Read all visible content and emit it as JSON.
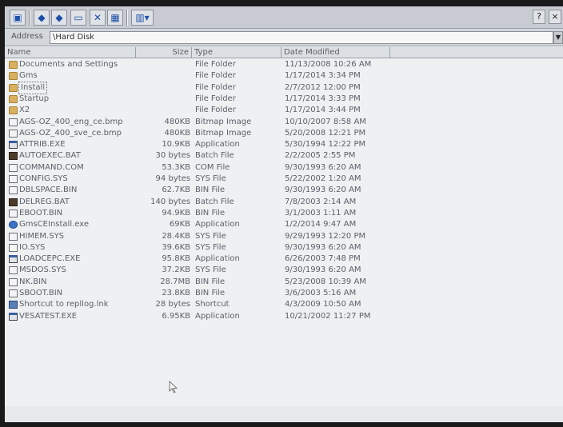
{
  "toolbar": {
    "help_label": "?",
    "close_label": "×",
    "buttons": [
      "back-icon",
      "forward-icon",
      "up-folder-icon",
      "delete-icon",
      "properties-icon",
      "views-icon"
    ]
  },
  "address": {
    "label": "Address",
    "value": "\\Hard Disk"
  },
  "columns": {
    "name": "Name",
    "size": "Size",
    "type": "Type",
    "date": "Date Modified"
  },
  "files": [
    {
      "name": "Documents and Settings",
      "size": "",
      "type": "File Folder",
      "date": "11/13/2008 10:26 AM",
      "icon": "folder-icon"
    },
    {
      "name": "Gms",
      "size": "",
      "type": "File Folder",
      "date": "1/17/2014 3:34 PM",
      "icon": "folder-icon"
    },
    {
      "name": "Install",
      "size": "",
      "type": "File Folder",
      "date": "2/7/2012 12:00 PM",
      "icon": "folder-icon"
    },
    {
      "name": "Startup",
      "size": "",
      "type": "File Folder",
      "date": "1/17/2014 3:33 PM",
      "icon": "folder-icon"
    },
    {
      "name": "X2",
      "size": "",
      "type": "File Folder",
      "date": "1/17/2014 3:44 PM",
      "icon": "folder-icon"
    },
    {
      "name": "AGS-OZ_400_eng_ce.bmp",
      "size": "480KB",
      "type": "Bitmap Image",
      "date": "10/10/2007 8:58 AM",
      "icon": "file-icon"
    },
    {
      "name": "AGS-OZ_400_sve_ce.bmp",
      "size": "480KB",
      "type": "Bitmap Image",
      "date": "5/20/2008 12:21 PM",
      "icon": "file-icon"
    },
    {
      "name": "ATTRIB.EXE",
      "size": "10.9KB",
      "type": "Application",
      "date": "5/30/1994 12:22 PM",
      "icon": "app-icon"
    },
    {
      "name": "AUTOEXEC.BAT",
      "size": "30 bytes",
      "type": "Batch File",
      "date": "2/2/2005 2:55 PM",
      "icon": "batch-icon"
    },
    {
      "name": "COMMAND.COM",
      "size": "53.3KB",
      "type": "COM File",
      "date": "9/30/1993 6:20 AM",
      "icon": "file-icon"
    },
    {
      "name": "CONFIG.SYS",
      "size": "94 bytes",
      "type": "SYS File",
      "date": "5/22/2002 1:20 AM",
      "icon": "file-icon"
    },
    {
      "name": "DBLSPACE.BIN",
      "size": "62.7KB",
      "type": "BIN File",
      "date": "9/30/1993 6:20 AM",
      "icon": "file-icon"
    },
    {
      "name": "DELREG.BAT",
      "size": "140 bytes",
      "type": "Batch File",
      "date": "7/8/2003 2:14 AM",
      "icon": "batch-icon"
    },
    {
      "name": "EBOOT.BIN",
      "size": "94.9KB",
      "type": "BIN File",
      "date": "3/1/2003 1:11 AM",
      "icon": "file-icon"
    },
    {
      "name": "GmsCEInstall.exe",
      "size": "69KB",
      "type": "Application",
      "date": "1/2/2014 9:47 AM",
      "icon": "setup-icon"
    },
    {
      "name": "HIMEM.SYS",
      "size": "28.4KB",
      "type": "SYS File",
      "date": "9/29/1993 12:20 PM",
      "icon": "file-icon"
    },
    {
      "name": "IO.SYS",
      "size": "39.6KB",
      "type": "SYS File",
      "date": "9/30/1993 6:20 AM",
      "icon": "file-icon"
    },
    {
      "name": "LOADCEPC.EXE",
      "size": "95.8KB",
      "type": "Application",
      "date": "6/26/2003 7:48 PM",
      "icon": "app-icon"
    },
    {
      "name": "MSDOS.SYS",
      "size": "37.2KB",
      "type": "SYS File",
      "date": "9/30/1993 6:20 AM",
      "icon": "file-icon"
    },
    {
      "name": "NK.BIN",
      "size": "28.7MB",
      "type": "BIN File",
      "date": "5/23/2008 10:39 AM",
      "icon": "file-icon"
    },
    {
      "name": "SBOOT.BIN",
      "size": "23.8KB",
      "type": "BIN File",
      "date": "3/6/2003 5:16 AM",
      "icon": "file-icon"
    },
    {
      "name": "Shortcut to repllog.lnk",
      "size": "28 bytes",
      "type": "Shortcut",
      "date": "4/3/2009 10:50 AM",
      "icon": "shortcut-icon"
    },
    {
      "name": "VESATEST.EXE",
      "size": "6.95KB",
      "type": "Application",
      "date": "10/21/2002 11:27 PM",
      "icon": "app-icon"
    }
  ]
}
